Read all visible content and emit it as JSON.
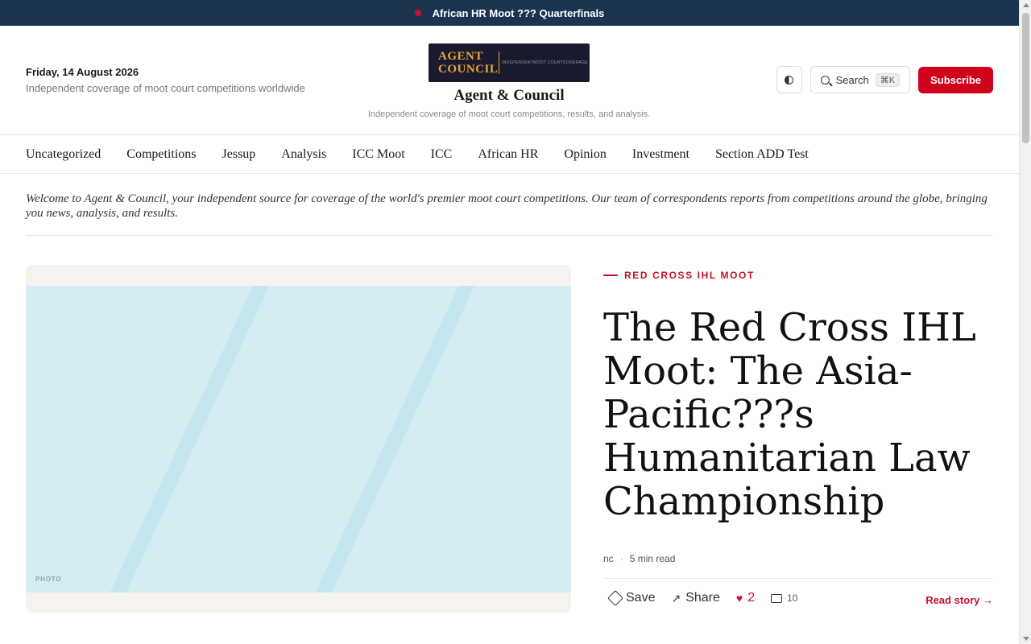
{
  "ticker": {
    "text": "African HR Moot ??? Quarterfinals"
  },
  "header": {
    "date": "Friday, 14 August 2026",
    "tagline_left": "Independent coverage of moot court competitions worldwide",
    "logo_text": "AGENT\nCOUNCIL",
    "logo_subtext": "INDEPENDENTMOOT COURTCOVERAGE",
    "site_name": "Agent & Council",
    "site_tagline": "Independent coverage of moot court competitions, results, and analysis.",
    "search_label": "Search",
    "search_shortcut": "⌘K",
    "subscribe_label": "Subscribe"
  },
  "nav": {
    "items": [
      "Uncategorized",
      "Competitions",
      "Jessup",
      "Analysis",
      "ICC Moot",
      "ICC",
      "African HR",
      "Opinion",
      "Investment",
      "Section ADD Test"
    ]
  },
  "welcome": {
    "text": "Welcome to Agent & Council, your independent source for coverage of the world's premier moot court competitions. Our team of correspondents reports from competitions around the globe, bringing you news, analysis, and results."
  },
  "feature": {
    "photo_label": "PHOTO",
    "kicker": "RED CROSS IHL MOOT",
    "headline": "The Red Cross IHL Moot: The Asia-Pacific???s Humanitarian Law Championship",
    "author": "nc",
    "read_time": "5 min read",
    "save_label": "Save",
    "share_label": "Share",
    "likes": "2",
    "comments": "10",
    "read_story_label": "Read story →"
  },
  "colors": {
    "ticker_bg": "#1b3550",
    "accent": "#c8102e",
    "subscribe": "#d0021b",
    "logo_bg": "#1a1a2e",
    "logo_gold": "#e8a53a"
  },
  "icons": [
    "live-dot-icon",
    "theme-toggle-icon",
    "search-icon",
    "tag-icon",
    "share-arrow-icon",
    "heart-icon",
    "comment-icon"
  ]
}
